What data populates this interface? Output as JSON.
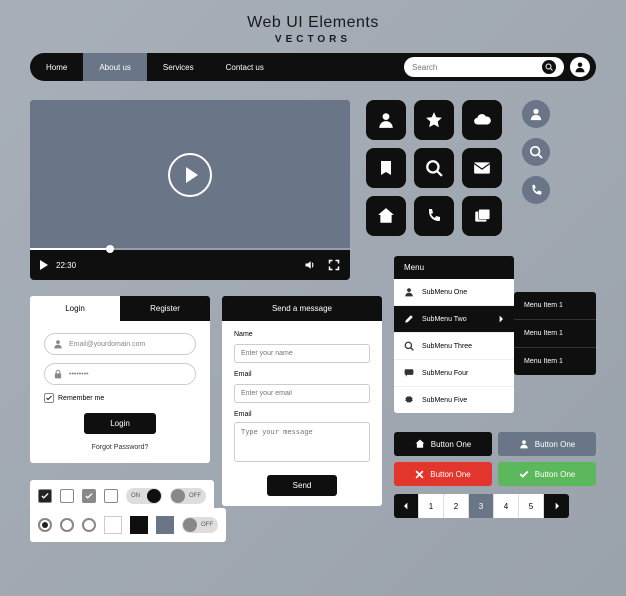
{
  "header": {
    "title": "Web UI Elements",
    "subtitle": "VECTORS"
  },
  "nav": {
    "items": [
      "Home",
      "About us",
      "Services",
      "Contact us"
    ],
    "active_index": 1,
    "search_placeholder": "Search"
  },
  "video": {
    "time": "22:30"
  },
  "login": {
    "tab_login": "Login",
    "tab_register": "Register",
    "email_placeholder": "Email@yourdomain.com",
    "password_placeholder": "••••••••",
    "remember": "Remember me",
    "login_button": "Login",
    "forgot": "Forgot Password?"
  },
  "message": {
    "header": "Send a message",
    "name_label": "Name",
    "name_placeholder": "Enter your name",
    "email_label": "Email",
    "email_placeholder": "Enter your email",
    "message_label": "Email",
    "message_placeholder": "Type your message",
    "send": "Send"
  },
  "menu": {
    "header": "Menu",
    "items": [
      "SubMenu One",
      "SubMenu Two",
      "SubMenu Three",
      "SubMenu Four",
      "SubMenu Five"
    ],
    "active_index": 1
  },
  "flyout": [
    "Menu Item 1",
    "Menu Item 1",
    "Menu Item 1"
  ],
  "buttons": {
    "b1": "Button One",
    "b2": "Button One",
    "b3": "Button One",
    "b4": "Button One"
  },
  "pagination": {
    "pages": [
      "1",
      "2",
      "3",
      "4",
      "5"
    ],
    "active_index": 2
  },
  "toggles": {
    "on": "ON",
    "off": "OFF"
  }
}
